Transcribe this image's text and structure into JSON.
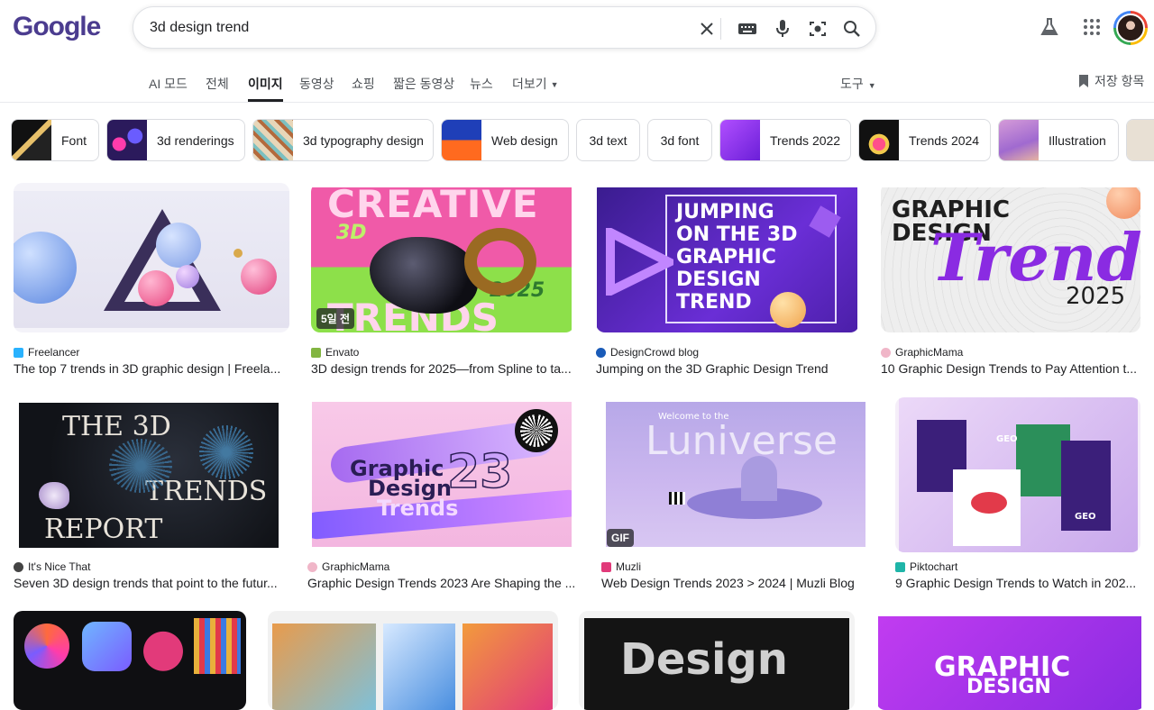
{
  "logo_text": "Google",
  "search": {
    "query": "3d design trend"
  },
  "icons": {
    "clear": "close-icon",
    "keyboard": "keyboard-icon",
    "mic": "microphone-icon",
    "lens": "camera-lens-icon",
    "search": "search-icon",
    "labs": "flask-icon",
    "apps": "apps-grid-icon"
  },
  "tabs": [
    {
      "label": "AI 모드"
    },
    {
      "label": "전체"
    },
    {
      "label": "이미지"
    },
    {
      "label": "동영상"
    },
    {
      "label": "쇼핑"
    },
    {
      "label": "짧은 동영상"
    },
    {
      "label": "뉴스"
    },
    {
      "label": "더보기"
    }
  ],
  "tools_label": "도구",
  "saved_label": "저장 항목",
  "chips": [
    {
      "label": "Font"
    },
    {
      "label": "3d renderings"
    },
    {
      "label": "3d typography design"
    },
    {
      "label": "Web design"
    },
    {
      "label": "3d text"
    },
    {
      "label": "3d font"
    },
    {
      "label": "Trends 2022"
    },
    {
      "label": "Trends 2024"
    },
    {
      "label": "Illustration"
    }
  ],
  "results": [
    {
      "source": "Freelancer",
      "title": "The top 7 trends in 3D graphic design | Freela..."
    },
    {
      "source": "Envato",
      "title": "3D design trends for 2025—from Spline to ta...",
      "badge": "5일 전",
      "art_top": "CREATIVE",
      "art_mid": "3D",
      "art_year": "2025",
      "art_bottom": "TRENDS"
    },
    {
      "source": "DesignCrowd blog",
      "title": "Jumping on the 3D Graphic Design Trend",
      "art_lines": [
        "JUMPING",
        "ON THE 3D",
        "GRAPHIC",
        "DESIGN",
        "TREND"
      ]
    },
    {
      "source": "GraphicMama",
      "title": "10 Graphic Design Trends to Pay Attention t...",
      "art_top": "GRAPHIC",
      "art_mid": "DESIGN",
      "art_script": "Trends",
      "art_year": "2025"
    },
    {
      "source": "It's Nice That",
      "title": "Seven 3D design trends that point to the futur...",
      "art_lines": [
        "THE 3D",
        "TRENDS",
        "REPORT"
      ]
    },
    {
      "source": "GraphicMama",
      "title": "Graphic Design Trends 2023 Are Shaping the ...",
      "art_lines": [
        "Graphic",
        "Design",
        "Trends"
      ],
      "art_year": "23"
    },
    {
      "source": "Muzli",
      "title": "Web Design Trends 2023 > 2024 | Muzli Blog",
      "badge": "GIF",
      "art_top": "Welcome to the",
      "art_mid": "Luniverse"
    },
    {
      "source": "Piktochart",
      "title": "9 Graphic Design Trends to Watch in 202...",
      "art_lines": [
        "GEO",
        "GEO"
      ]
    },
    {
      "source": "",
      "title": ""
    },
    {
      "source": "",
      "title": ""
    },
    {
      "source": "",
      "title": "",
      "art_mid": "Design"
    },
    {
      "source": "",
      "title": "",
      "art_lines": [
        "GRAPHIC",
        "DESIGN"
      ]
    }
  ]
}
